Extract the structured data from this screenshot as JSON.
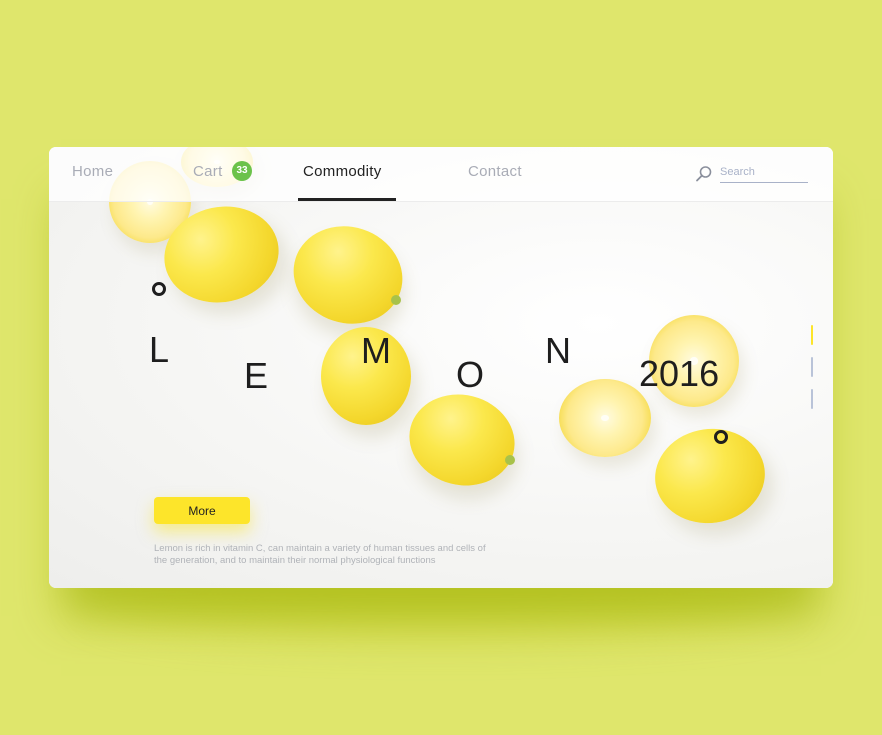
{
  "nav": {
    "items": [
      {
        "label": "Home"
      },
      {
        "label": "Cart"
      },
      {
        "label": "Commodity"
      },
      {
        "label": "Contact"
      }
    ],
    "cart_count": "33",
    "active": "Commodity"
  },
  "search": {
    "placeholder": "Search"
  },
  "hero": {
    "letters": [
      "L",
      "E",
      "M",
      "O",
      "N"
    ],
    "year": "2016",
    "button_label": "More",
    "description_line1": "Lemon is rich in vitamin C, can maintain a variety of human tissues and cells of",
    "description_line2": "the generation, and to maintain their normal physiological functions"
  },
  "slides": {
    "count": 3,
    "active": 1
  },
  "colors": {
    "background": "#dfe66c",
    "accent": "#fde52a",
    "badge": "#6bc24a",
    "indicator_active": "#fde52a",
    "indicator_inactive": "#b9c3d8"
  },
  "icons": [
    "search-icon"
  ]
}
